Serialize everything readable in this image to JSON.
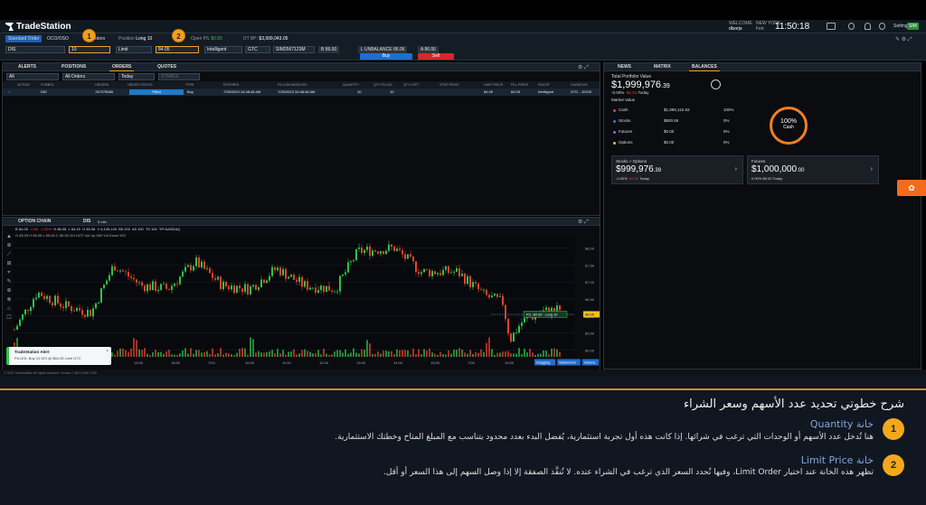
{
  "app": {
    "brand": "TradeStation",
    "clock": "11:50:18",
    "welcome_label": "WELCOME",
    "user": "dlsorje",
    "ny_time_label": "NEW YORK",
    "ny_date": "Feb",
    "settings": "Settings",
    "sim": "SIM"
  },
  "order_bar": {
    "order_type_tab": "Standard Order",
    "oco_tab": "OCO/OSO",
    "extra_tab": "Orders",
    "position_label": "Position",
    "position_value": "Long 10",
    "open_pl_label": "Open P/L",
    "open_pl_value": "$0.65",
    "bp_label": "DT BP:",
    "bp_value": "$3,999,043.05",
    "symbol": "DIS",
    "quantity": "10",
    "order_type": "Limit",
    "limit_price": "84.05",
    "route": "Intelligent",
    "duration": "GTC",
    "account": "SIM2567123M",
    "bid_label": "B",
    "bid_value": "86.00",
    "unbalance_label": "L UNBALANCE",
    "unbalance_value": "86.06",
    "ask_label": "A",
    "ask_value": "86.06",
    "buy": "Buy",
    "sell": "Sell"
  },
  "badges": [
    "1",
    "2"
  ],
  "orders_panel": {
    "tabs": [
      "ALERTS",
      "POSITIONS",
      "ORDERS",
      "QUOTES"
    ],
    "filter_all": "All",
    "filter_orders": "All Orders",
    "filter_today": "Today",
    "symbol_placeholder": "SYMBOL",
    "headers": [
      "ACTION",
      "SYMBOL",
      "ORDER#",
      "ORDER STATUS",
      "TYPE",
      "ENTERED",
      "FILLED/CANCELED",
      "QUANTITY",
      "QTY FILLED",
      "QTY LEFT",
      "STOP PRICE",
      "LIMIT PRICE",
      "FILL PRICE",
      "ROUTE",
      "DURATION"
    ],
    "row": {
      "action": "",
      "symbol": "DIS",
      "order": "787375565",
      "status": "Filled",
      "type": "Buy",
      "entered": "7/25/2023 10:48:48 AM",
      "filled": "7/25/2023 10:48:48 AM",
      "quantity": "10",
      "qty_filled": "10",
      "qty_left": "",
      "stop": "",
      "limit": "84.05",
      "fill": "84.05",
      "route": "Intelligent",
      "duration": "GTC - 10/23/"
    }
  },
  "chart_panel": {
    "tabs": [
      "OPTION CHAIN",
      "DIS",
      "5 min"
    ],
    "quote_strip": [
      "B 84.05",
      "-0.86",
      "-1.06%",
      "H 86.08",
      "L 84.15",
      "O 85.08",
      "V 6,105,100",
      "B5 200",
      "A5 100",
      "TS 100",
      "TR NASDAQ"
    ],
    "ohlc": "O 85.05  H 85.06  L 85.06  C 85.05  Vol 1572  Vol Up 650  Vol Down 922",
    "price_ticks": [
      "88.00",
      "87.50",
      "87.00",
      "86.50",
      "86.00",
      "85.50",
      "85.00"
    ],
    "time_ticks": [
      "7/21",
      "12:00",
      "13:00",
      "14:00",
      "15:00",
      "7/24",
      "10:00",
      "11:00",
      "12:00",
      "13:00",
      "14:00",
      "15:00",
      "7/25",
      "10:00",
      "11:00"
    ],
    "position_label": "P/L: $0.65 · Long 10",
    "price_marker": "86.05",
    "alert_title": "TradeStation Alert",
    "alert_text": "FILLED: Buy 10 DIS @ $84.05 Limit GTC",
    "bottom_btns": [
      "Dragging",
      "Watermark",
      "Volume"
    ],
    "footer": "© 2023 TradeStation   All rights reserved.   Version 7.38.0.0455.7005"
  },
  "balances_panel": {
    "tabs": [
      "NEWS",
      "MATRIX",
      "BALANCES"
    ],
    "title": "Total Portfolio Value",
    "value": "$1,999,976",
    "value_cents": ".39",
    "change": "-0.00%",
    "change_amt": "-$1.01",
    "change_period": "Today",
    "market_value_label": "Market Value",
    "items": [
      {
        "name": "Cash",
        "amount": "$1,999,115.93",
        "pct": "100%",
        "color": "#e8412c"
      },
      {
        "name": "Stocks",
        "amount": "$900.55",
        "pct": "0%",
        "color": "#2f7fe0"
      },
      {
        "name": "Futures",
        "amount": "$0.00",
        "pct": "0%",
        "color": "#9c5ee0"
      },
      {
        "name": "Options",
        "amount": "$0.00",
        "pct": "0%",
        "color": "#e8c12c"
      }
    ],
    "ring_pct": "100%",
    "ring_label": "Cash",
    "card1": {
      "title": "Stocks + Options",
      "value": "$999,976",
      "cents": ".39",
      "change": "-0.00%",
      "change_amt": "-$1.01",
      "period": "Today"
    },
    "card2": {
      "title": "Futures",
      "value": "$1,000,000",
      "cents": ".00",
      "change": "0.00%",
      "change_amt": "$0.00",
      "period": "Today"
    }
  },
  "explanation": {
    "heading": "شرح خطوتي تحديد عدد الأسهم وسعر الشراء",
    "steps": [
      {
        "num": "1",
        "title": "خانة Quantity",
        "text": "هنا تُدخل عدد الأسهم أو الوحدات التي ترغب في شرائها. إذا كانت هذه أول تجربة استثمارية، يُفضل البدء بعدد محدود يتناسب مع المبلغ المتاح وخطتك الاستثمارية."
      },
      {
        "num": "2",
        "title": "خانة Limit Price",
        "text": "تظهر هذه الخانة عند اختيار Limit Order، وفيها تُحدد السعر الذي ترغب في الشراء عنده. لا تُنفَّذ الصفقة إلا إذا وصل السهم إلى هذا السعر أو أقل."
      }
    ]
  },
  "colors": {
    "accent": "#f0a020",
    "up": "#2ec24a",
    "down": "#e8412c",
    "blue": "#1f7ac9"
  }
}
